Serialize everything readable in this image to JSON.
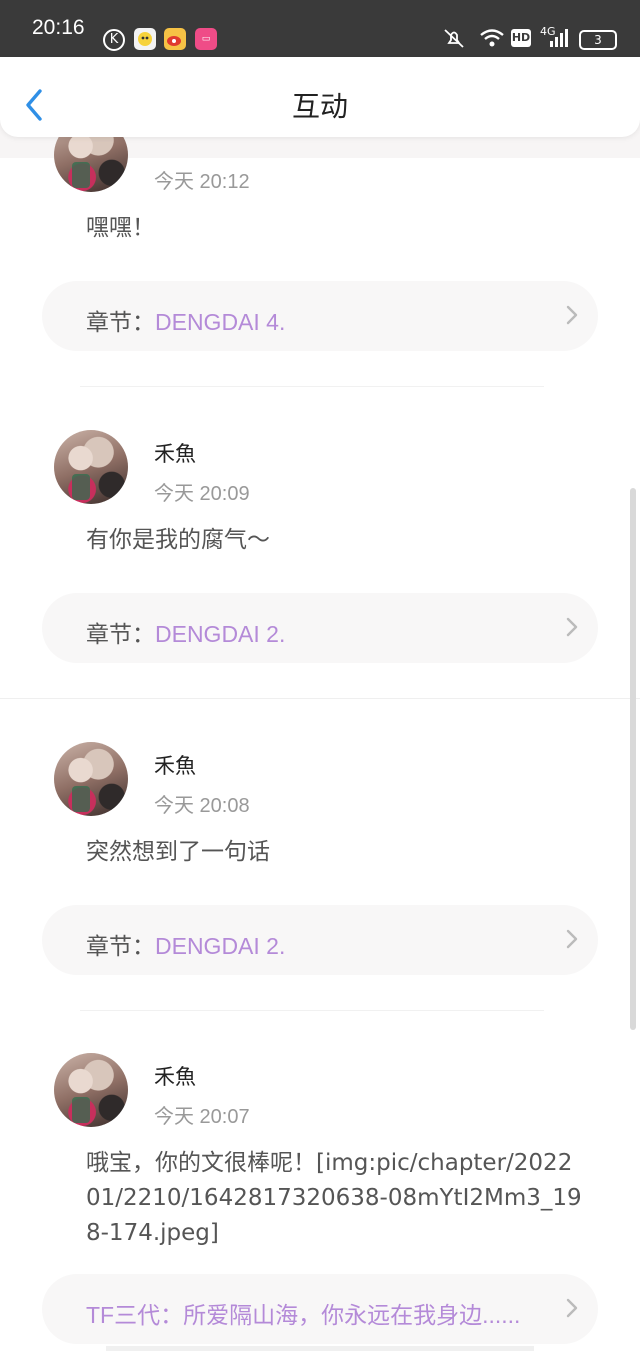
{
  "status_bar": {
    "time": "20:16",
    "app_icons": [
      "k-app-icon",
      "wechat-mini-icon",
      "weibo-icon",
      "pink-app-icon"
    ],
    "signal_text": "4G",
    "hd_label": "HD",
    "battery": "3"
  },
  "header": {
    "title": "互动",
    "back_icon": "chevron-left-icon"
  },
  "items": [
    {
      "name": "",
      "time": "今天 20:12",
      "comment": "嘿嘿！",
      "chapter_label": "章节：",
      "chapter_value": "DENGDAI 4."
    },
    {
      "name": "禾魚",
      "time": "今天 20:09",
      "comment": "有你是我的腐气～",
      "chapter_label": "章节：",
      "chapter_value": "DENGDAI 2."
    },
    {
      "name": "禾魚",
      "time": "今天 20:08",
      "comment": "突然想到了一句话",
      "chapter_label": "章节：",
      "chapter_value": "DENGDAI 2."
    },
    {
      "name": "禾魚",
      "time": "今天 20:07",
      "comment": "哦宝，你的文很棒呢！[img:pic/chapter/202201/2210/1642817320638-08mYtI2Mm3_198-174.jpeg]",
      "chapter_label": "",
      "chapter_value": "TF三代：所爱隔山海，你永远在我身边......"
    }
  ],
  "colors": {
    "accent_blue": "#2f8fe6",
    "chapter_purple": "#b48ad8",
    "status_bar_bg": "#3a3a3a"
  }
}
